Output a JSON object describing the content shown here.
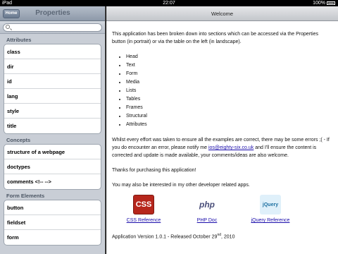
{
  "status": {
    "device": "iPad",
    "time": "22:07",
    "battery": "100%"
  },
  "left": {
    "home_label": "Home",
    "title": "Properties",
    "search_placeholder": "",
    "sections": [
      {
        "header": "Attributes",
        "items": [
          "class",
          "dir",
          "id",
          "lang",
          "style",
          "title"
        ]
      },
      {
        "header": "Concepts",
        "items": [
          "structure of a webpage",
          "doctypes",
          "comments <!-- -->"
        ]
      },
      {
        "header": "Form Elements",
        "items": [
          "button",
          "fieldset",
          "form"
        ]
      }
    ]
  },
  "right": {
    "title": "Welcome",
    "intro": "This application has been broken down into sections which can be accessed via the Properties button (in portrait) or via the table on the left (in landscape).",
    "list": [
      "Head",
      "Text",
      "Form",
      "Media",
      "Lists",
      "Tables",
      "Frames",
      "Structural",
      "Attributes"
    ],
    "errors_before": "Whilst every effort was taken to ensure all the examples are correct, there may be some errors ;( - If you do encounter an error, please notify me ",
    "email": "ios@eighty-six.co.uk",
    "errors_after": " and I'll ensure the content is corrected and update is made available, your comments/ideas are also welcome.",
    "thanks": "Thanks for purchasing this application!",
    "interest": "You may also be interested in my other developer related apps.",
    "apps": [
      {
        "icon_text": "CSS",
        "icon": "css-icon",
        "label": "CSS Reference"
      },
      {
        "icon_text": "php",
        "icon": "php-icon",
        "label": "PHP Doc"
      },
      {
        "icon_text": "jQuery",
        "icon": "jquery-icon",
        "label": "jQuery Reference"
      }
    ],
    "version_before": "Application Version 1.0.1 - Released October 29",
    "version_sup": "nd",
    "version_after": ", 2010"
  }
}
